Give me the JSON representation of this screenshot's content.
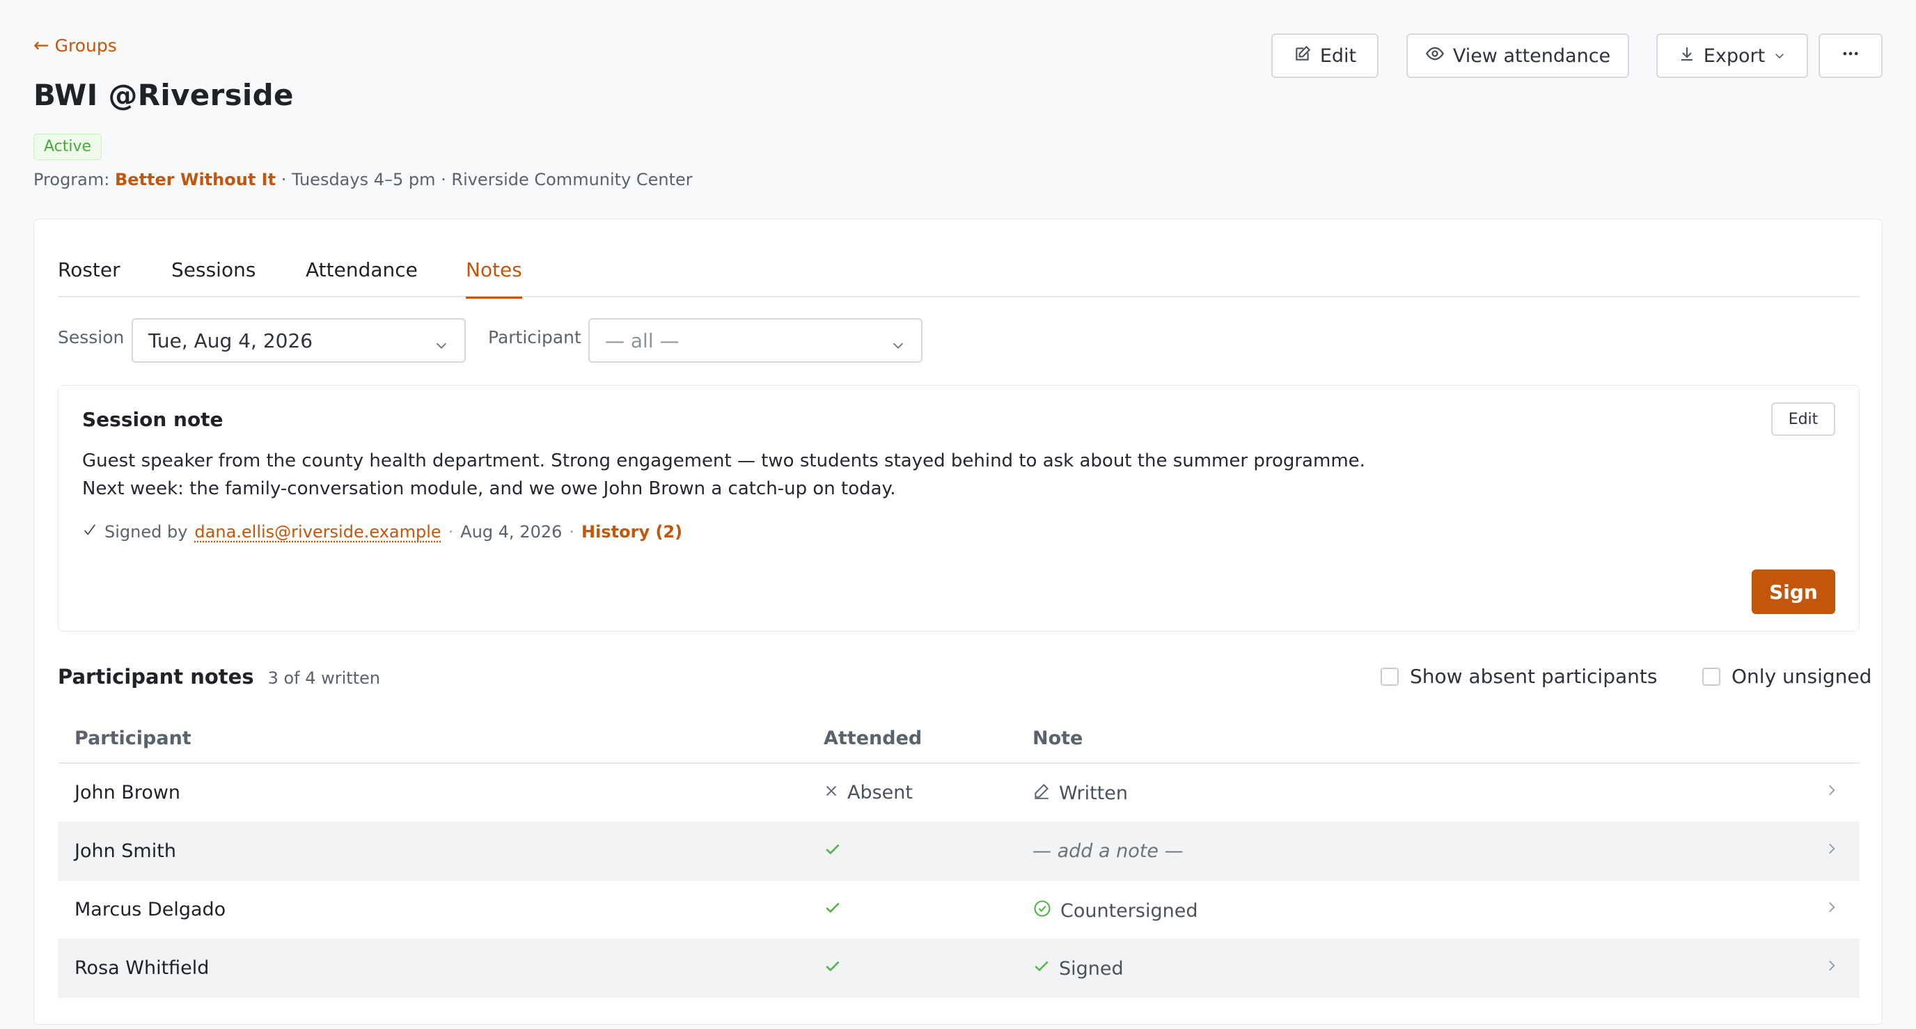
{
  "header": {
    "back_label": "Groups",
    "title": "BWI @Riverside",
    "status": "Active",
    "meta_prefix": "Program:",
    "program": "Better Without It",
    "meta_suffix": "· Tuesdays 4–5 pm · Riverside Community Center",
    "buttons": {
      "edit": "Edit",
      "view_attendance": "View attendance",
      "export": "Export"
    }
  },
  "tabs": [
    {
      "label": "Roster",
      "active": false
    },
    {
      "label": "Sessions",
      "active": false
    },
    {
      "label": "Attendance",
      "active": false
    },
    {
      "label": "Notes",
      "active": true
    }
  ],
  "filters": {
    "session_label": "Session",
    "session_value": "Tue, Aug 4, 2026",
    "participant_label": "Participant",
    "participant_value": "— all —"
  },
  "session_note": {
    "title": "Session note",
    "edit_label": "Edit",
    "line1": "Guest speaker from the county health department. Strong engagement — two students stayed behind to ask about the summer programme.",
    "line2": "Next week: the family-conversation module, and we owe John Brown a catch-up on today.",
    "signed_prefix": "Signed by",
    "signed_by": "dana.ellis@riverside.example",
    "signed_date": "Aug 4, 2026",
    "history_label": "History (2)",
    "sign_label": "Sign"
  },
  "participant_notes": {
    "title": "Participant notes",
    "count": "3 of 4 written",
    "show_absent_label": "Show absent participants",
    "only_unsigned_label": "Only unsigned",
    "columns": [
      "Participant",
      "Attended",
      "Note"
    ],
    "rows": [
      {
        "name": "John Brown",
        "attended": "Absent",
        "note": "Written"
      },
      {
        "name": "John Smith",
        "attended": "",
        "note": "— add a note —"
      },
      {
        "name": "Marcus Delgado",
        "attended": "",
        "note": "Countersigned"
      },
      {
        "name": "Rosa Whitfield",
        "attended": "",
        "note": "Signed"
      }
    ]
  },
  "colors": {
    "accent": "#c2570c",
    "success": "#52b34a",
    "badge_bg": "#eefbea"
  }
}
